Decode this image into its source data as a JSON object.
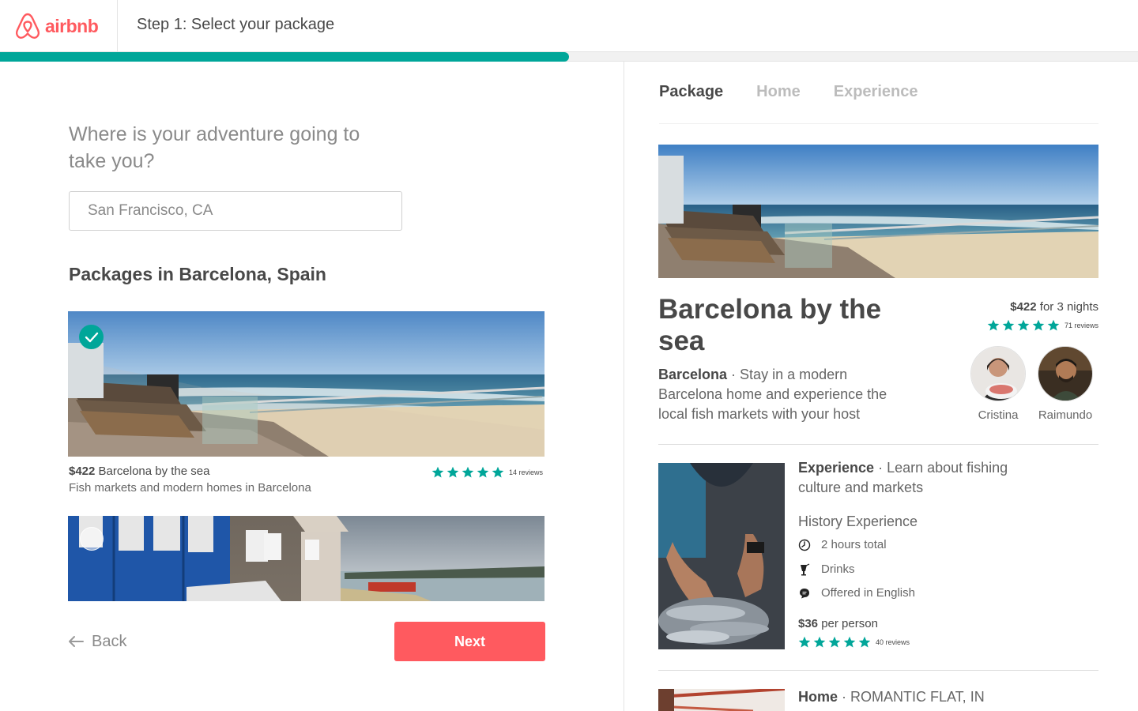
{
  "brand": {
    "name": "airbnb",
    "color": "#ff5a5f",
    "accent": "#00a699"
  },
  "header": {
    "step_title": "Step 1: Select your package",
    "progress": 0.5
  },
  "left": {
    "question": "Where is your adventure going to take you?",
    "location_input": {
      "value": "San Francisco, CA"
    },
    "section_title": "Packages in Barcelona, Spain",
    "packages": [
      {
        "price": "$422",
        "title": "Barcelona by the sea",
        "subtitle": "Fish markets and modern homes in Barcelona",
        "reviews": "14 reviews",
        "stars": 5,
        "selected": true
      },
      {
        "selected": false
      }
    ],
    "back_label": "Back",
    "next_label": "Next"
  },
  "right": {
    "tabs": [
      {
        "label": "Package",
        "active": true
      },
      {
        "label": "Home",
        "active": false
      },
      {
        "label": "Experience",
        "active": false
      }
    ],
    "package": {
      "name": "Barcelona by the sea",
      "price": "$422",
      "price_suffix": "for 3 nights",
      "reviews": "71 reviews",
      "stars": 5,
      "city": "Barcelona",
      "description": "Stay in a modern Barcelona home and experience the local fish markets with your host"
    },
    "hosts": [
      {
        "name": "Cristina"
      },
      {
        "name": "Raimundo"
      }
    ],
    "experience": {
      "label": "Experience",
      "headline": "Learn about fishing culture and markets",
      "category": "History Experience",
      "items": [
        {
          "icon": "clock-icon",
          "text": "2 hours total"
        },
        {
          "icon": "drinks-icon",
          "text": "Drinks"
        },
        {
          "icon": "chat-icon",
          "text": "Offered in English"
        }
      ],
      "price": "$36",
      "price_suffix": "per person",
      "reviews": "40 reviews",
      "stars": 5
    },
    "home": {
      "label": "Home",
      "headline": "ROMANTIC FLAT, IN"
    }
  }
}
